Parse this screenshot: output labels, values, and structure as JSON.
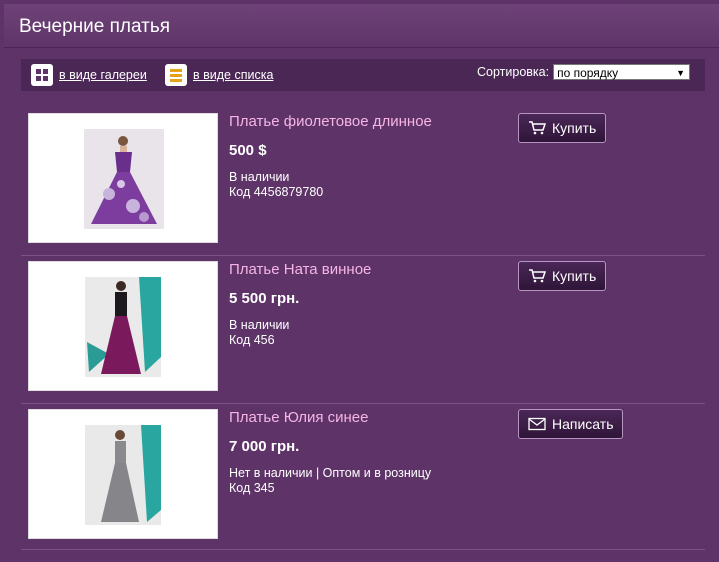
{
  "header": {
    "title": "Вечерние платья"
  },
  "toolbar": {
    "gallery_label": "в виде галереи",
    "list_label": "в виде списка",
    "sort_label": "Сортировка:",
    "sort_value": "по порядку"
  },
  "products": [
    {
      "name": "Платье фиолетовое длинное",
      "price": "500 $",
      "stock": "В наличии",
      "code": "Код 4456879780",
      "action": "Купить",
      "action_icon": "cart-icon"
    },
    {
      "name": "Платье Ната винное",
      "price": "5 500 грн.",
      "stock": "В наличии",
      "code": "Код 456",
      "action": "Купить",
      "action_icon": "cart-icon"
    },
    {
      "name": "Платье Юлия синее",
      "price": "7 000 грн.",
      "stock": "Нет в наличии | Оптом и в розницу",
      "code": "Код 345",
      "action": "Написать",
      "action_icon": "envelope-icon"
    }
  ],
  "colors": {
    "background": "#5e3468",
    "toolbar": "#4b2756",
    "product_name": "#f6b5e6",
    "list_icon": "#e8a21a"
  }
}
